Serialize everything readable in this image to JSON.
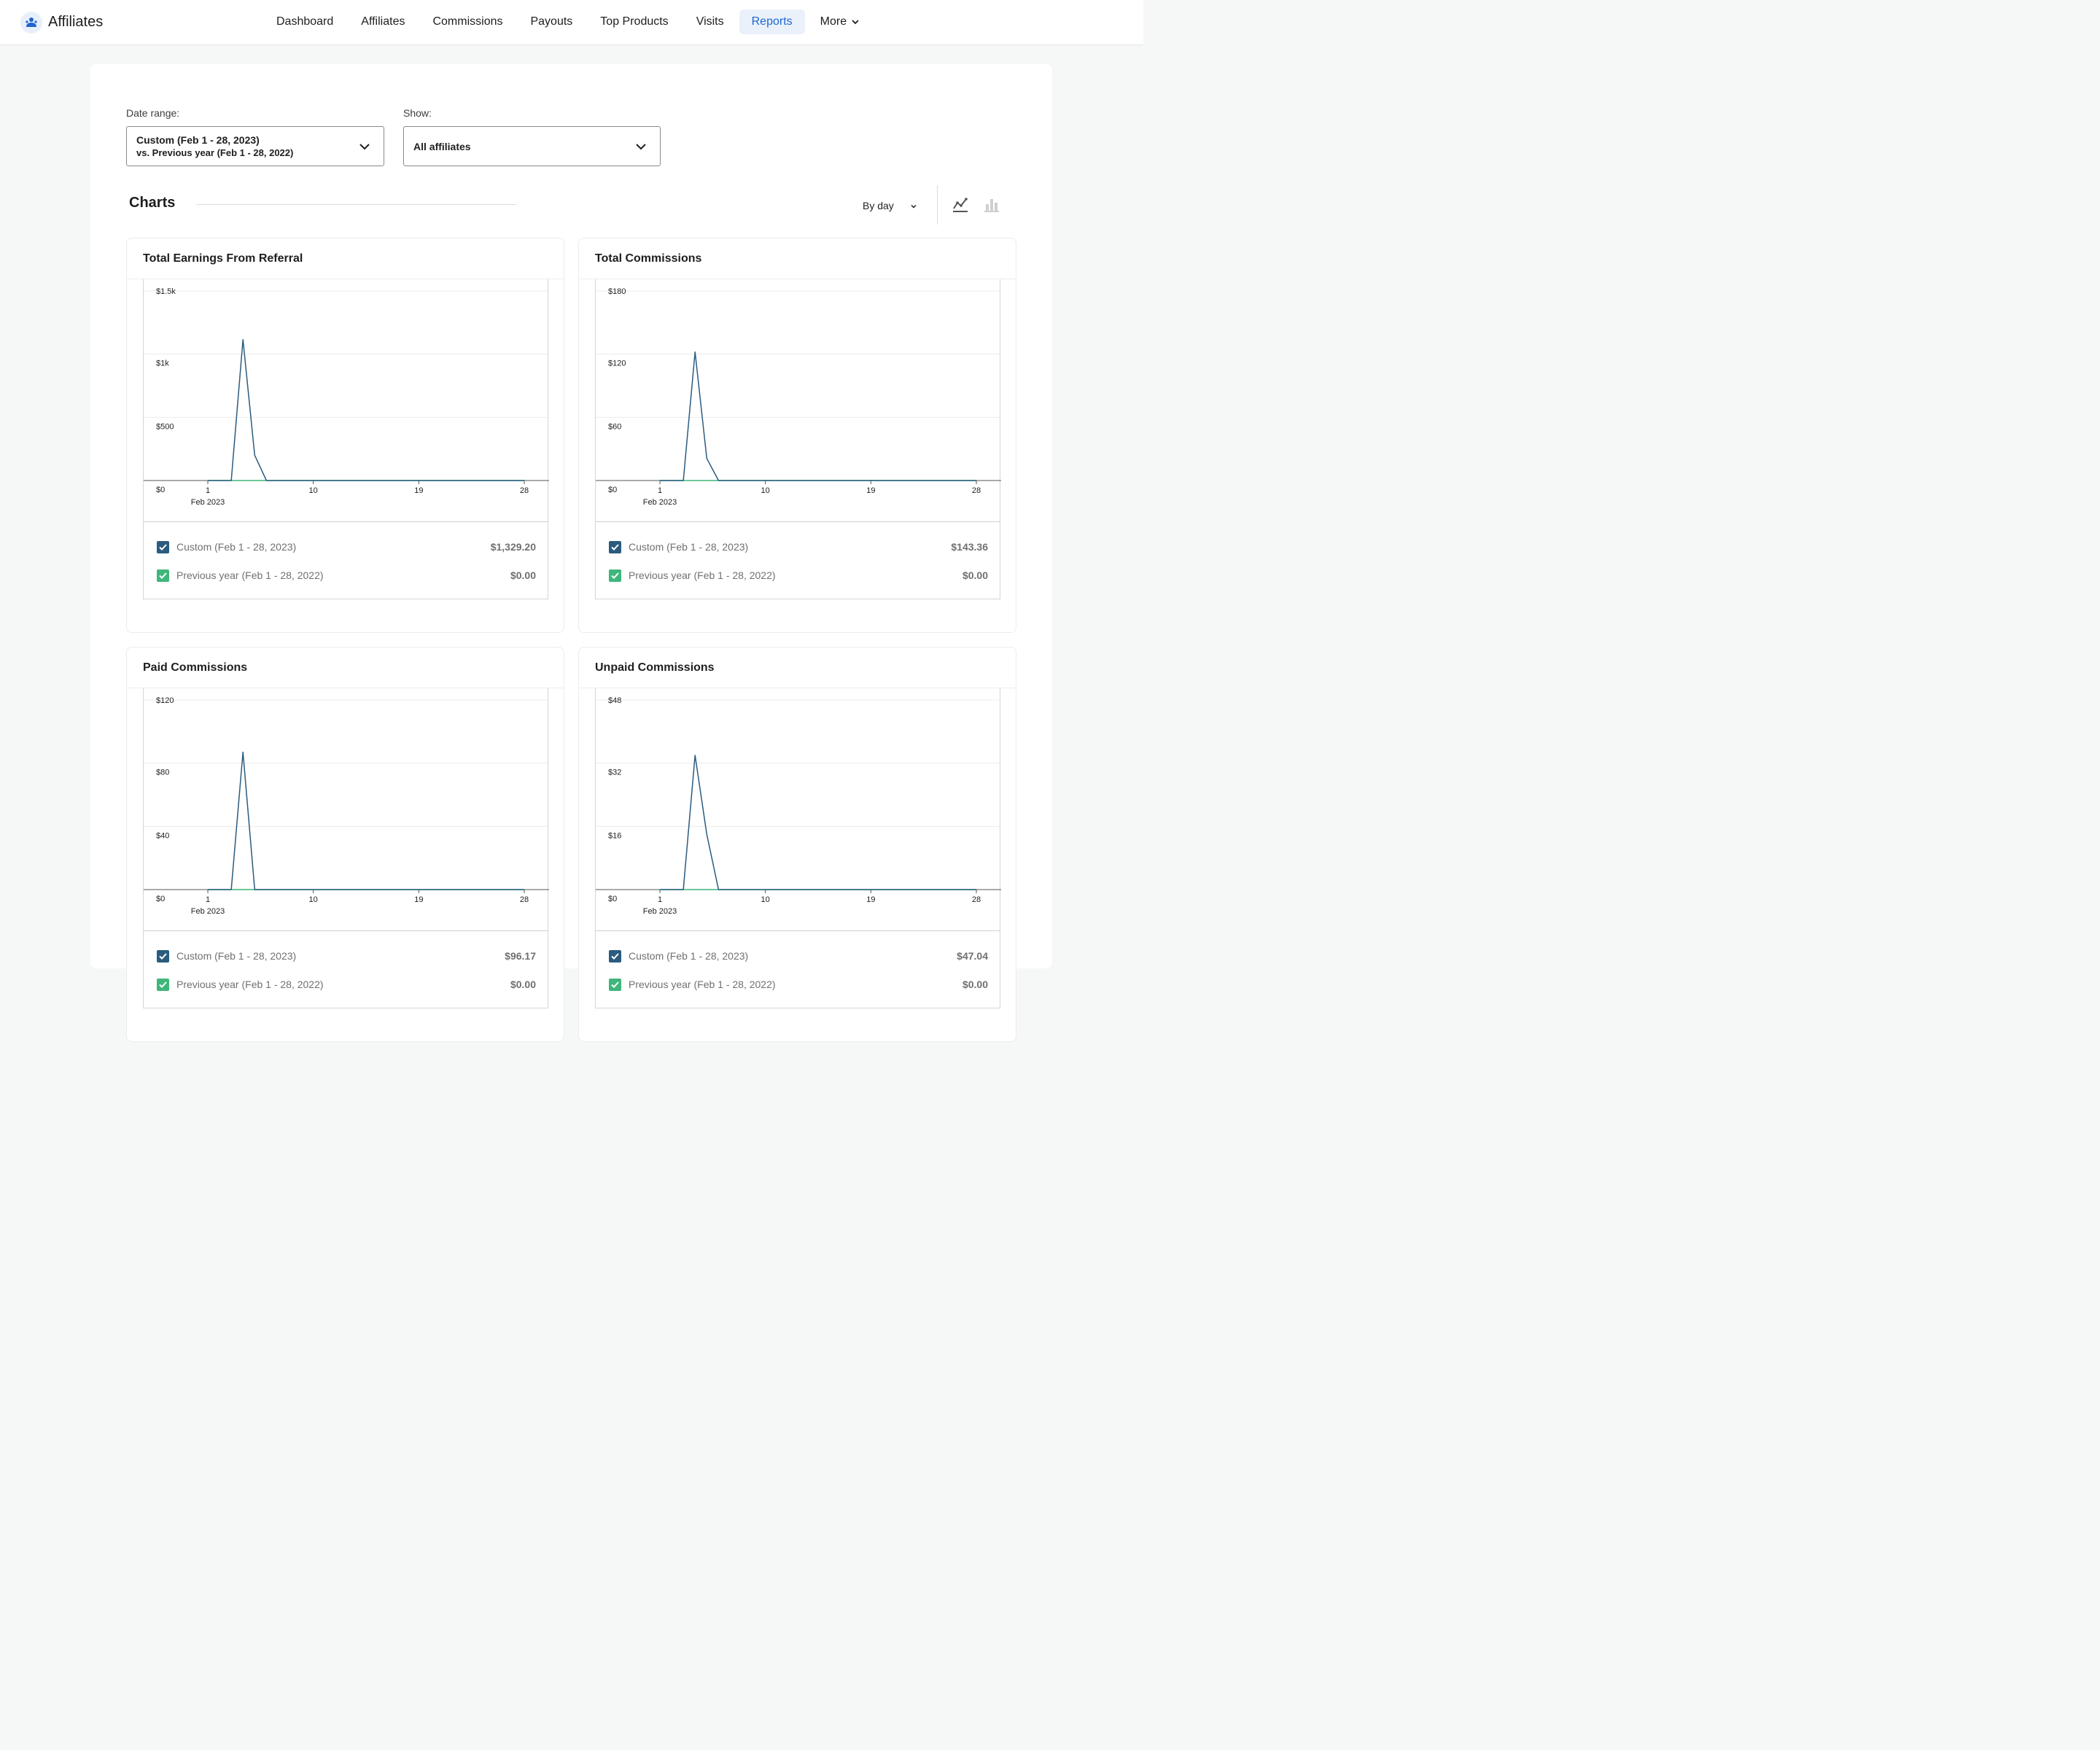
{
  "app": {
    "name": "Affiliates",
    "logo_icon": "affiliates-logo-icon"
  },
  "nav": {
    "items": [
      {
        "label": "Dashboard",
        "active": false
      },
      {
        "label": "Affiliates",
        "active": false
      },
      {
        "label": "Commissions",
        "active": false
      },
      {
        "label": "Payouts",
        "active": false
      },
      {
        "label": "Top Products",
        "active": false
      },
      {
        "label": "Visits",
        "active": false
      },
      {
        "label": "Reports",
        "active": true
      }
    ],
    "more_label": "More"
  },
  "filters": {
    "date_range_label": "Date range:",
    "date_range_value": "Custom (Feb 1 - 28, 2023)",
    "date_range_compare": "vs. Previous year (Feb 1 - 28, 2022)",
    "show_label": "Show:",
    "show_value": "All affiliates"
  },
  "charts_section": {
    "title": "Charts",
    "interval": "By day",
    "line_icon": "line-chart-icon",
    "bar_icon": "bar-chart-icon"
  },
  "colors": {
    "accent": "#1f66d1",
    "current_series": "#2b5c7f",
    "previous_series": "#3fb67a"
  },
  "cards": [
    {
      "title": "Total Earnings From Referral",
      "legend": [
        {
          "label": "Custom (Feb 1 - 28, 2023)",
          "value": "$1,329.20"
        },
        {
          "label": "Previous year (Feb 1 - 28, 2022)",
          "value": "$0.00"
        }
      ]
    },
    {
      "title": "Total Commissions",
      "legend": [
        {
          "label": "Custom (Feb 1 - 28, 2023)",
          "value": "$143.36"
        },
        {
          "label": "Previous year (Feb 1 - 28, 2022)",
          "value": "$0.00"
        }
      ]
    },
    {
      "title": "Paid Commissions",
      "legend": [
        {
          "label": "Custom (Feb 1 - 28, 2023)",
          "value": "$96.17"
        },
        {
          "label": "Previous year (Feb 1 - 28, 2022)",
          "value": "$0.00"
        }
      ]
    },
    {
      "title": "Unpaid Commissions",
      "legend": [
        {
          "label": "Custom (Feb 1 - 28, 2023)",
          "value": "$47.04"
        },
        {
          "label": "Previous year (Feb 1 - 28, 2022)",
          "value": "$0.00"
        }
      ]
    }
  ],
  "chart_data": [
    {
      "type": "line",
      "title": "Total Earnings From Referral",
      "x": [
        1,
        2,
        3,
        4,
        5,
        6,
        7,
        8,
        9,
        10,
        11,
        12,
        13,
        14,
        15,
        16,
        17,
        18,
        19,
        20,
        21,
        22,
        23,
        24,
        25,
        26,
        27,
        28
      ],
      "x_tick_labels": [
        "1",
        "10",
        "19",
        "28"
      ],
      "x_secondary_label": "Feb 2023",
      "y_tick_labels": [
        "$0",
        "$500",
        "$1k",
        "$1.5k"
      ],
      "y_ticks": [
        0,
        500,
        1000,
        1500
      ],
      "ylim": [
        0,
        1500
      ],
      "series": [
        {
          "name": "Custom (Feb 1 - 28, 2023)",
          "values": [
            0,
            0,
            0,
            1115,
            200,
            0,
            0,
            0,
            0,
            0,
            0,
            0,
            0,
            0,
            0,
            0,
            0,
            0,
            0,
            0,
            0,
            0,
            0,
            0,
            0,
            0,
            0,
            0
          ]
        },
        {
          "name": "Previous year (Feb 1 - 28, 2022)",
          "values": [
            0,
            0,
            0,
            0,
            0,
            0,
            0,
            0,
            0,
            0,
            0,
            0,
            0,
            0,
            0,
            0,
            0,
            0,
            0,
            0,
            0,
            0,
            0,
            0,
            0,
            0,
            0,
            0
          ]
        }
      ]
    },
    {
      "type": "line",
      "title": "Total Commissions",
      "x": [
        1,
        2,
        3,
        4,
        5,
        6,
        7,
        8,
        9,
        10,
        11,
        12,
        13,
        14,
        15,
        16,
        17,
        18,
        19,
        20,
        21,
        22,
        23,
        24,
        25,
        26,
        27,
        28
      ],
      "x_tick_labels": [
        "1",
        "10",
        "19",
        "28"
      ],
      "x_secondary_label": "Feb 2023",
      "y_tick_labels": [
        "$0",
        "$60",
        "$120",
        "$180"
      ],
      "y_ticks": [
        0,
        60,
        120,
        180
      ],
      "ylim": [
        0,
        180
      ],
      "series": [
        {
          "name": "Custom (Feb 1 - 28, 2023)",
          "values": [
            0,
            0,
            0,
            122,
            21,
            0,
            0,
            0,
            0,
            0,
            0,
            0,
            0,
            0,
            0,
            0,
            0,
            0,
            0,
            0,
            0,
            0,
            0,
            0,
            0,
            0,
            0,
            0
          ]
        },
        {
          "name": "Previous year (Feb 1 - 28, 2022)",
          "values": [
            0,
            0,
            0,
            0,
            0,
            0,
            0,
            0,
            0,
            0,
            0,
            0,
            0,
            0,
            0,
            0,
            0,
            0,
            0,
            0,
            0,
            0,
            0,
            0,
            0,
            0,
            0,
            0
          ]
        }
      ]
    },
    {
      "type": "line",
      "title": "Paid Commissions",
      "x": [
        1,
        2,
        3,
        4,
        5,
        6,
        7,
        8,
        9,
        10,
        11,
        12,
        13,
        14,
        15,
        16,
        17,
        18,
        19,
        20,
        21,
        22,
        23,
        24,
        25,
        26,
        27,
        28
      ],
      "x_tick_labels": [
        "1",
        "10",
        "19",
        "28"
      ],
      "x_secondary_label": "Feb 2023",
      "y_tick_labels": [
        "$0",
        "$40",
        "$80",
        "$120"
      ],
      "y_ticks": [
        0,
        40,
        80,
        120
      ],
      "ylim": [
        0,
        120
      ],
      "series": [
        {
          "name": "Custom (Feb 1 - 28, 2023)",
          "values": [
            0,
            0,
            0,
            87,
            0,
            0,
            0,
            0,
            0,
            0,
            0,
            0,
            0,
            0,
            0,
            0,
            0,
            0,
            0,
            0,
            0,
            0,
            0,
            0,
            0,
            0,
            0,
            0
          ]
        },
        {
          "name": "Previous year (Feb 1 - 28, 2022)",
          "values": [
            0,
            0,
            0,
            0,
            0,
            0,
            0,
            0,
            0,
            0,
            0,
            0,
            0,
            0,
            0,
            0,
            0,
            0,
            0,
            0,
            0,
            0,
            0,
            0,
            0,
            0,
            0,
            0
          ]
        }
      ]
    },
    {
      "type": "line",
      "title": "Unpaid Commissions",
      "x": [
        1,
        2,
        3,
        4,
        5,
        6,
        7,
        8,
        9,
        10,
        11,
        12,
        13,
        14,
        15,
        16,
        17,
        18,
        19,
        20,
        21,
        22,
        23,
        24,
        25,
        26,
        27,
        28
      ],
      "x_tick_labels": [
        "1",
        "10",
        "19",
        "28"
      ],
      "x_secondary_label": "Feb 2023",
      "y_tick_labels": [
        "$0",
        "$16",
        "$32",
        "$48"
      ],
      "y_ticks": [
        0,
        16,
        32,
        48
      ],
      "ylim": [
        0,
        48
      ],
      "series": [
        {
          "name": "Custom (Feb 1 - 28, 2023)",
          "values": [
            0,
            0,
            0,
            34,
            14,
            0,
            0,
            0,
            0,
            0,
            0,
            0,
            0,
            0,
            0,
            0,
            0,
            0,
            0,
            0,
            0,
            0,
            0,
            0,
            0,
            0,
            0,
            0
          ]
        },
        {
          "name": "Previous year (Feb 1 - 28, 2022)",
          "values": [
            0,
            0,
            0,
            0,
            0,
            0,
            0,
            0,
            0,
            0,
            0,
            0,
            0,
            0,
            0,
            0,
            0,
            0,
            0,
            0,
            0,
            0,
            0,
            0,
            0,
            0,
            0,
            0
          ]
        }
      ]
    }
  ]
}
